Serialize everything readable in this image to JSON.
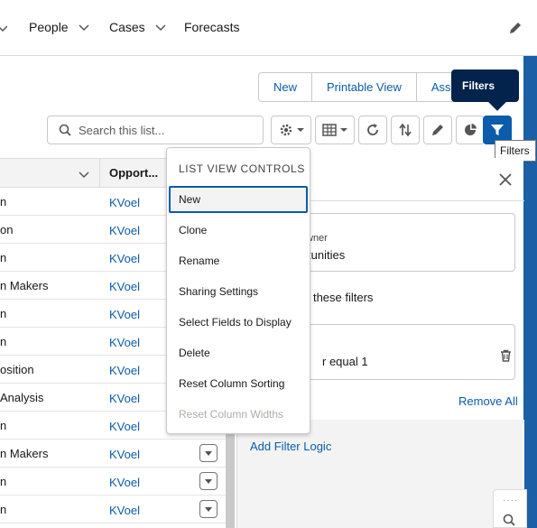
{
  "nav": {
    "items": [
      {
        "label": "People",
        "has_menu": true
      },
      {
        "label": "Cases",
        "has_menu": true
      },
      {
        "label": "Forecasts",
        "has_menu": false
      }
    ]
  },
  "toolbar": {
    "buttons": [
      "New",
      "Printable View",
      "Assi"
    ],
    "search_placeholder": "Search this list...",
    "filters_popover": "Filters",
    "filters_tooltip": "Filters"
  },
  "table": {
    "column_header": "Opport...",
    "rows": [
      {
        "col1": "n",
        "col2": "KVoel",
        "menu": false
      },
      {
        "col1": "on",
        "col2": "KVoel",
        "menu": false
      },
      {
        "col1": "n",
        "col2": "KVoel",
        "menu": false
      },
      {
        "col1": "n Makers",
        "col2": "KVoel",
        "menu": false
      },
      {
        "col1": "n",
        "col2": "KVoel",
        "menu": false
      },
      {
        "col1": "n",
        "col2": "KVoel",
        "menu": false
      },
      {
        "col1": "osition",
        "col2": "KVoel",
        "menu": false
      },
      {
        "col1": " Analysis",
        "col2": "KVoel",
        "menu": false
      },
      {
        "col1": "n",
        "col2": "KVoel",
        "menu": false
      },
      {
        "col1": "n Makers",
        "col2": "KVoel",
        "menu": true
      },
      {
        "col1": "n",
        "col2": "KVoel",
        "menu": true
      },
      {
        "col1": "n",
        "col2": "KVoel",
        "menu": true
      },
      {
        "col1": "",
        "col2": "",
        "menu": true
      }
    ]
  },
  "list_view_controls": {
    "title": "LIST VIEW CONTROLS",
    "items": [
      {
        "label": "New",
        "state": "focused"
      },
      {
        "label": "Clone",
        "state": "normal"
      },
      {
        "label": "Rename",
        "state": "normal"
      },
      {
        "label": "Sharing Settings",
        "state": "normal"
      },
      {
        "label": "Select Fields to Display",
        "state": "normal"
      },
      {
        "label": "Delete",
        "state": "normal"
      },
      {
        "label": "Reset Column Sorting",
        "state": "normal"
      },
      {
        "label": "Reset Column Widths",
        "state": "disabled"
      }
    ]
  },
  "filters_panel": {
    "owner_small": "wner",
    "owner_value": "tunities",
    "match_text": "l of these filters",
    "filter_value": "r equal 1",
    "remove_all": "Remove All",
    "add_filter_logic": "Add Filter Logic"
  },
  "colors": {
    "brand_blue": "#0b5cab",
    "dark_navy": "#03234d",
    "gutter_blue": "#1b5fa6"
  }
}
